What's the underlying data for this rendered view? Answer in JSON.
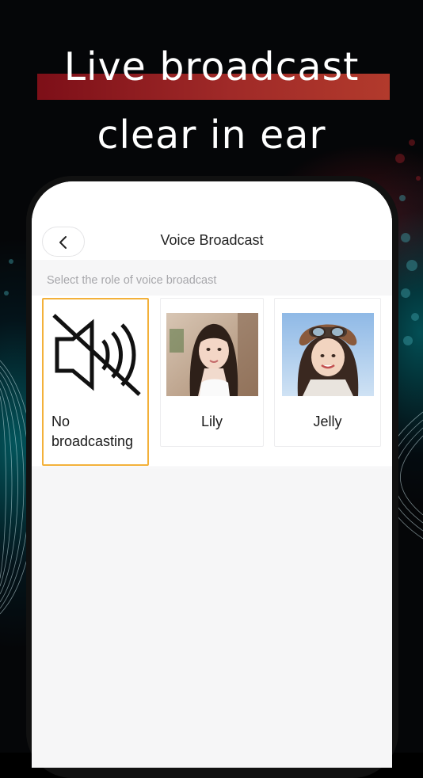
{
  "promo": {
    "line1": "Live broadcast",
    "line2": "clear in ear",
    "accent_color": "#a02a28"
  },
  "nav": {
    "title": "Voice Broadcast",
    "back_icon": "chevron-left-icon"
  },
  "section": {
    "hint": "Select the role of voice broadcast"
  },
  "roles": [
    {
      "label_line1": "No",
      "label_line2": "broadcasting",
      "icon": "speaker-muted-icon",
      "selected": true
    },
    {
      "label": "Lily",
      "selected": false
    },
    {
      "label": "Jelly",
      "selected": false
    }
  ],
  "colors": {
    "selected_border": "#f3b13a",
    "background": "#000000",
    "screen": "#f6f6f7"
  }
}
